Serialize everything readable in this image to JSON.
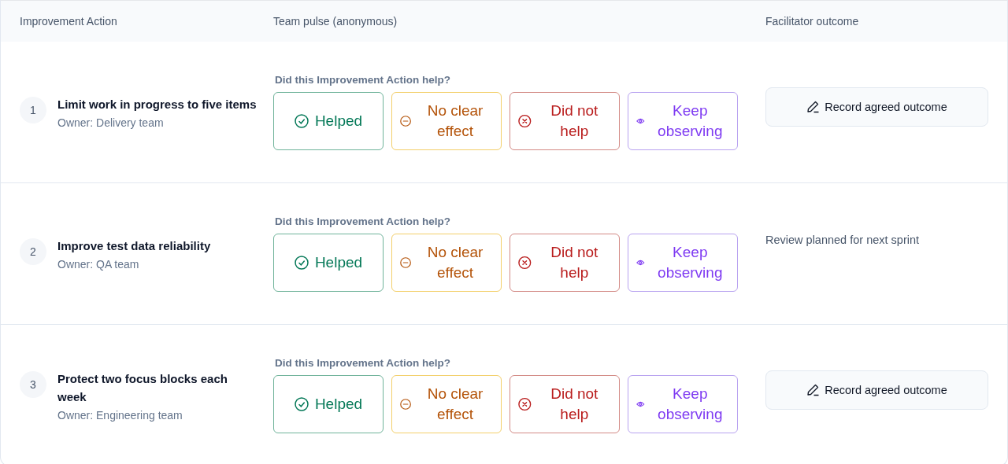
{
  "table": {
    "columns": [
      "Improvement Action",
      "Team pulse (anonymous)",
      "Facilitator outcome"
    ],
    "rows": [
      {
        "number": "1",
        "title": "Limit work in progress to five items",
        "owner_label": "Owner:",
        "owner": "Delivery team",
        "question": "Did this Improvement Action help?",
        "options": [
          {
            "kind": "helped",
            "label": "Helped"
          },
          {
            "kind": "no_effect",
            "label": "No clear effect"
          },
          {
            "kind": "did_not_help",
            "label": "Did not help"
          },
          {
            "kind": "keep_observing",
            "label": "Keep observing"
          }
        ],
        "outcome": {
          "kind": "button",
          "label": "Record agreed outcome"
        }
      },
      {
        "number": "2",
        "title": "Improve test data reliability",
        "owner_label": "Owner:",
        "owner": "QA team",
        "question": "Did this Improvement Action help?",
        "options": [
          {
            "kind": "helped",
            "label": "Helped"
          },
          {
            "kind": "no_effect",
            "label": "No clear effect"
          },
          {
            "kind": "did_not_help",
            "label": "Did not help"
          },
          {
            "kind": "keep_observing",
            "label": "Keep observing"
          }
        ],
        "outcome": {
          "kind": "text",
          "label": "Review planned for next sprint"
        }
      },
      {
        "number": "3",
        "title": "Protect two focus blocks each week",
        "owner_label": "Owner:",
        "owner": "Engineering team",
        "question": "Did this Improvement Action help?",
        "options": [
          {
            "kind": "helped",
            "label": "Helped"
          },
          {
            "kind": "no_effect",
            "label": "No clear effect"
          },
          {
            "kind": "did_not_help",
            "label": "Did not help"
          },
          {
            "kind": "keep_observing",
            "label": "Keep observing"
          }
        ],
        "outcome": {
          "kind": "button",
          "label": "Record agreed outcome"
        }
      }
    ]
  }
}
